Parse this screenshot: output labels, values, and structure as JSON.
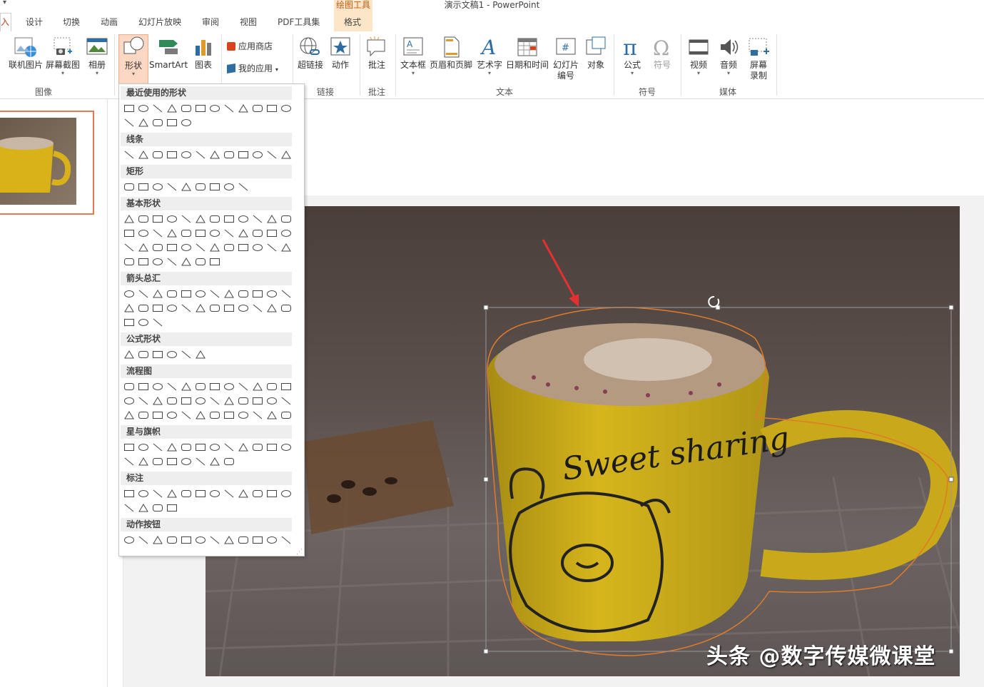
{
  "window": {
    "title": "演示文稿1 - PowerPoint",
    "qat_glyph": "▾",
    "context_group": "绘图工具"
  },
  "tabs": {
    "insert_edge": "入",
    "design": "设计",
    "transitions": "切换",
    "animations": "动画",
    "slideshow": "幻灯片放映",
    "review": "审阅",
    "view": "视图",
    "pdf": "PDF工具集",
    "format": "格式"
  },
  "ribbon": {
    "online_pictures": "联机图片",
    "screenshot": "屏幕截图",
    "album": "相册",
    "shapes": "形状",
    "smartart": "SmartArt",
    "chart": "图表",
    "store": "应用商店",
    "my_apps": "我的应用",
    "hyperlink": "超链接",
    "action": "动作",
    "comment": "批注",
    "textbox": "文本框",
    "header_footer": "页眉和页脚",
    "wordart": "艺术字",
    "datetime": "日期和时间",
    "slide_number_l1": "幻灯片",
    "slide_number_l2": "编号",
    "object": "对象",
    "equation": "公式",
    "symbol": "符号",
    "video": "视频",
    "audio": "音频",
    "screen_rec_l1": "屏幕",
    "screen_rec_l2": "录制",
    "groups": {
      "images": "图像",
      "links": "链接",
      "comments": "批注",
      "text": "文本",
      "symbols": "符号",
      "media": "媒体"
    }
  },
  "dropdown": {
    "sections": [
      "最近使用的形状",
      "线条",
      "矩形",
      "基本形状",
      "箭头总汇",
      "公式形状",
      "流程图",
      "星与旗帜",
      "标注",
      "动作按钮"
    ]
  },
  "slide": {
    "cup_text": "Sweet sharing",
    "watermark": "头条 @数字传媒微课堂"
  },
  "colors": {
    "accent": "#c43e1c",
    "selection": "#e07b53",
    "context": "#fde6c8"
  }
}
